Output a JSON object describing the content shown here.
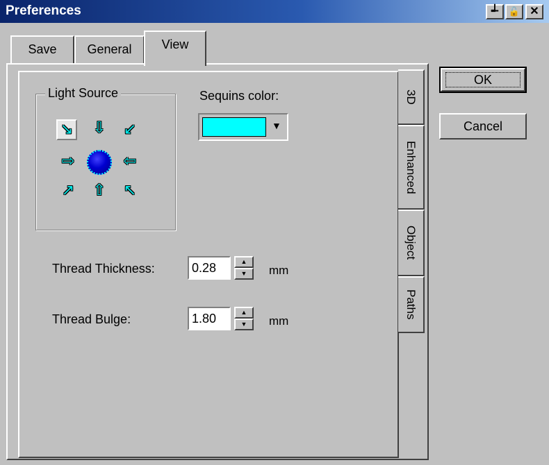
{
  "window": {
    "title": "Preferences",
    "controls": {
      "pin": "┵",
      "lock": "🔓",
      "close": "✕"
    }
  },
  "tabs": [
    {
      "label": "Save",
      "active": false
    },
    {
      "label": "General",
      "active": false
    },
    {
      "label": "View",
      "active": true
    }
  ],
  "view_tabs": [
    {
      "label": "3D",
      "active": true
    },
    {
      "label": "Enhanced",
      "active": false
    },
    {
      "label": "Object",
      "active": false
    },
    {
      "label": "Paths",
      "active": false
    }
  ],
  "light_source": {
    "label": "Light Source",
    "arrows": [
      "↘",
      "⇩",
      "↙",
      "⇨",
      "⇦",
      "↗",
      "⇧",
      "↖"
    ],
    "selected_index": 0
  },
  "sequins": {
    "label": "Sequins color:",
    "color": "#00ffff",
    "dropdown_icon": "▼"
  },
  "thread_thickness": {
    "label": "Thread Thickness:",
    "value": "0.28",
    "unit": "mm"
  },
  "thread_bulge": {
    "label": "Thread Bulge:",
    "value": "1.80",
    "unit": "mm"
  },
  "spin_icons": {
    "up": "▲",
    "down": "▼"
  },
  "buttons": {
    "ok": "OK",
    "cancel": "Cancel"
  },
  "colors": {
    "accent": "#0a246a",
    "face": "#c0c0c0"
  }
}
